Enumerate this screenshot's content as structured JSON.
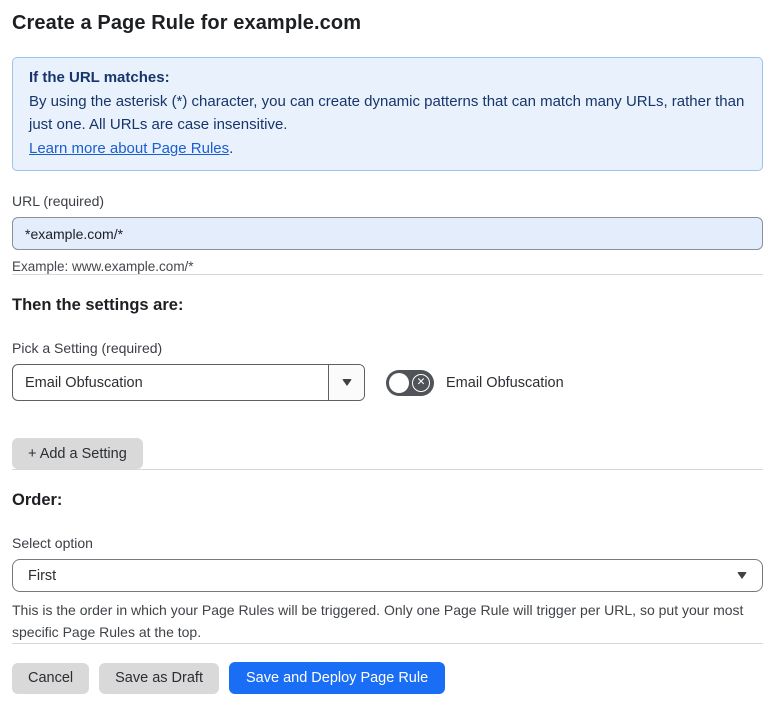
{
  "page": {
    "title": "Create a Page Rule for example.com"
  },
  "info_box": {
    "heading": "If the URL matches:",
    "body": "By using the asterisk (*) character, you can create dynamic patterns that can match many URLs, rather than just one. All URLs are case insensitive.",
    "link_label": "Learn more about Page Rules",
    "link_suffix": "."
  },
  "url_field": {
    "label": "URL (required)",
    "value": "*example.com/*",
    "example": "Example: www.example.com/*"
  },
  "settings_section": {
    "heading": "Then the settings are:",
    "picker_label": "Pick a Setting (required)",
    "picker_value": "Email Obfuscation",
    "toggle_label": "Email Obfuscation",
    "toggle_state": "off",
    "toggle_x_glyph": "✕",
    "add_button_label": "+ Add a Setting"
  },
  "order_section": {
    "heading": "Order:",
    "select_label": "Select option",
    "select_value": "First",
    "help_text": "This is the order in which your Page Rules will be triggered. Only one Page Rule will trigger per URL, so put your most specific Page Rules at the top."
  },
  "footer": {
    "cancel_label": "Cancel",
    "save_draft_label": "Save as Draft",
    "save_deploy_label": "Save and Deploy Page Rule"
  },
  "colors": {
    "accent_blue": "#1a6ef5",
    "info_background": "#e9f2fc",
    "info_border": "#9dc2ed",
    "info_text": "#17356b",
    "link_blue": "#1b5ecf",
    "input_background": "#e3edfb",
    "toggle_off_background": "#505459",
    "gray_button_background": "#d9d9da"
  }
}
